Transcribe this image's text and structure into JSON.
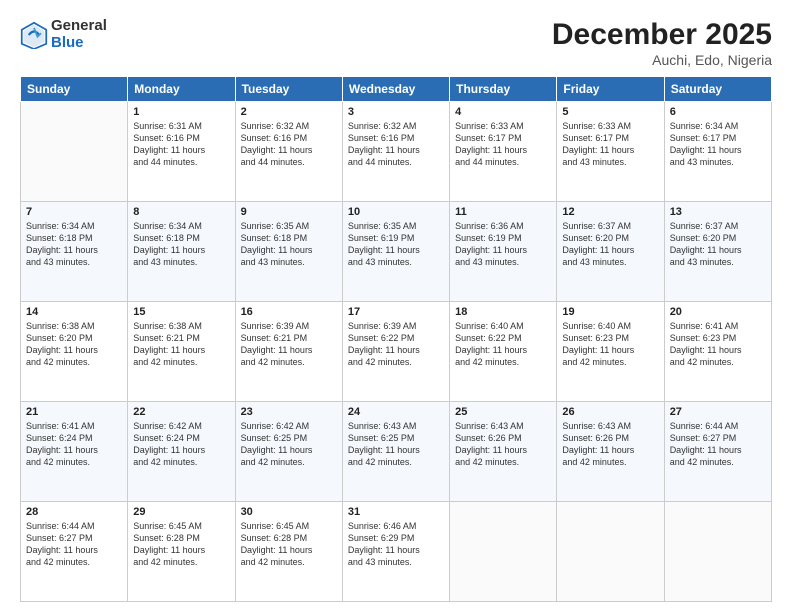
{
  "header": {
    "logo_general": "General",
    "logo_blue": "Blue",
    "month_title": "December 2025",
    "location": "Auchi, Edo, Nigeria"
  },
  "days_of_week": [
    "Sunday",
    "Monday",
    "Tuesday",
    "Wednesday",
    "Thursday",
    "Friday",
    "Saturday"
  ],
  "weeks": [
    [
      {
        "day": "",
        "info": ""
      },
      {
        "day": "1",
        "info": "Sunrise: 6:31 AM\nSunset: 6:16 PM\nDaylight: 11 hours\nand 44 minutes."
      },
      {
        "day": "2",
        "info": "Sunrise: 6:32 AM\nSunset: 6:16 PM\nDaylight: 11 hours\nand 44 minutes."
      },
      {
        "day": "3",
        "info": "Sunrise: 6:32 AM\nSunset: 6:16 PM\nDaylight: 11 hours\nand 44 minutes."
      },
      {
        "day": "4",
        "info": "Sunrise: 6:33 AM\nSunset: 6:17 PM\nDaylight: 11 hours\nand 44 minutes."
      },
      {
        "day": "5",
        "info": "Sunrise: 6:33 AM\nSunset: 6:17 PM\nDaylight: 11 hours\nand 43 minutes."
      },
      {
        "day": "6",
        "info": "Sunrise: 6:34 AM\nSunset: 6:17 PM\nDaylight: 11 hours\nand 43 minutes."
      }
    ],
    [
      {
        "day": "7",
        "info": "Sunrise: 6:34 AM\nSunset: 6:18 PM\nDaylight: 11 hours\nand 43 minutes."
      },
      {
        "day": "8",
        "info": "Sunrise: 6:34 AM\nSunset: 6:18 PM\nDaylight: 11 hours\nand 43 minutes."
      },
      {
        "day": "9",
        "info": "Sunrise: 6:35 AM\nSunset: 6:18 PM\nDaylight: 11 hours\nand 43 minutes."
      },
      {
        "day": "10",
        "info": "Sunrise: 6:35 AM\nSunset: 6:19 PM\nDaylight: 11 hours\nand 43 minutes."
      },
      {
        "day": "11",
        "info": "Sunrise: 6:36 AM\nSunset: 6:19 PM\nDaylight: 11 hours\nand 43 minutes."
      },
      {
        "day": "12",
        "info": "Sunrise: 6:37 AM\nSunset: 6:20 PM\nDaylight: 11 hours\nand 43 minutes."
      },
      {
        "day": "13",
        "info": "Sunrise: 6:37 AM\nSunset: 6:20 PM\nDaylight: 11 hours\nand 43 minutes."
      }
    ],
    [
      {
        "day": "14",
        "info": "Sunrise: 6:38 AM\nSunset: 6:20 PM\nDaylight: 11 hours\nand 42 minutes."
      },
      {
        "day": "15",
        "info": "Sunrise: 6:38 AM\nSunset: 6:21 PM\nDaylight: 11 hours\nand 42 minutes."
      },
      {
        "day": "16",
        "info": "Sunrise: 6:39 AM\nSunset: 6:21 PM\nDaylight: 11 hours\nand 42 minutes."
      },
      {
        "day": "17",
        "info": "Sunrise: 6:39 AM\nSunset: 6:22 PM\nDaylight: 11 hours\nand 42 minutes."
      },
      {
        "day": "18",
        "info": "Sunrise: 6:40 AM\nSunset: 6:22 PM\nDaylight: 11 hours\nand 42 minutes."
      },
      {
        "day": "19",
        "info": "Sunrise: 6:40 AM\nSunset: 6:23 PM\nDaylight: 11 hours\nand 42 minutes."
      },
      {
        "day": "20",
        "info": "Sunrise: 6:41 AM\nSunset: 6:23 PM\nDaylight: 11 hours\nand 42 minutes."
      }
    ],
    [
      {
        "day": "21",
        "info": "Sunrise: 6:41 AM\nSunset: 6:24 PM\nDaylight: 11 hours\nand 42 minutes."
      },
      {
        "day": "22",
        "info": "Sunrise: 6:42 AM\nSunset: 6:24 PM\nDaylight: 11 hours\nand 42 minutes."
      },
      {
        "day": "23",
        "info": "Sunrise: 6:42 AM\nSunset: 6:25 PM\nDaylight: 11 hours\nand 42 minutes."
      },
      {
        "day": "24",
        "info": "Sunrise: 6:43 AM\nSunset: 6:25 PM\nDaylight: 11 hours\nand 42 minutes."
      },
      {
        "day": "25",
        "info": "Sunrise: 6:43 AM\nSunset: 6:26 PM\nDaylight: 11 hours\nand 42 minutes."
      },
      {
        "day": "26",
        "info": "Sunrise: 6:43 AM\nSunset: 6:26 PM\nDaylight: 11 hours\nand 42 minutes."
      },
      {
        "day": "27",
        "info": "Sunrise: 6:44 AM\nSunset: 6:27 PM\nDaylight: 11 hours\nand 42 minutes."
      }
    ],
    [
      {
        "day": "28",
        "info": "Sunrise: 6:44 AM\nSunset: 6:27 PM\nDaylight: 11 hours\nand 42 minutes."
      },
      {
        "day": "29",
        "info": "Sunrise: 6:45 AM\nSunset: 6:28 PM\nDaylight: 11 hours\nand 42 minutes."
      },
      {
        "day": "30",
        "info": "Sunrise: 6:45 AM\nSunset: 6:28 PM\nDaylight: 11 hours\nand 42 minutes."
      },
      {
        "day": "31",
        "info": "Sunrise: 6:46 AM\nSunset: 6:29 PM\nDaylight: 11 hours\nand 43 minutes."
      },
      {
        "day": "",
        "info": ""
      },
      {
        "day": "",
        "info": ""
      },
      {
        "day": "",
        "info": ""
      }
    ]
  ]
}
